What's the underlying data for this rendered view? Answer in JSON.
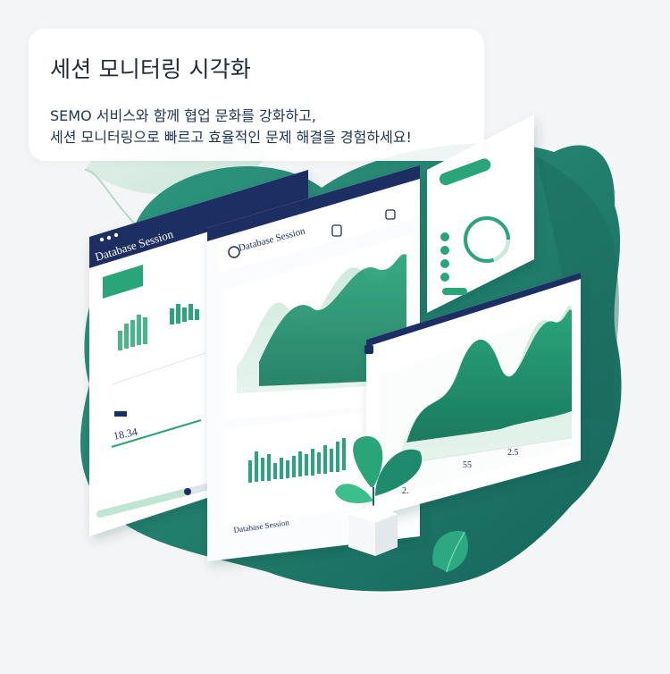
{
  "card": {
    "title": "세션 모니터링 시각화",
    "description_line1": "SEMO 서비스와 함께 협업 문화를 강화하고,",
    "description_line2": "세션 모니터링으로 빠르고 효율적인 문제 해결을 경험하세요!"
  },
  "illustration": {
    "left_window_title": "Database Session",
    "center_window_title": "Database Session",
    "bottom_window_title": "Database Session"
  },
  "colors": {
    "background": "#f4f5f6",
    "blob_green": "#1f7c6b",
    "accent_green": "#2fa877",
    "light_green": "#bfe6d3",
    "navy": "#1e2f62"
  }
}
